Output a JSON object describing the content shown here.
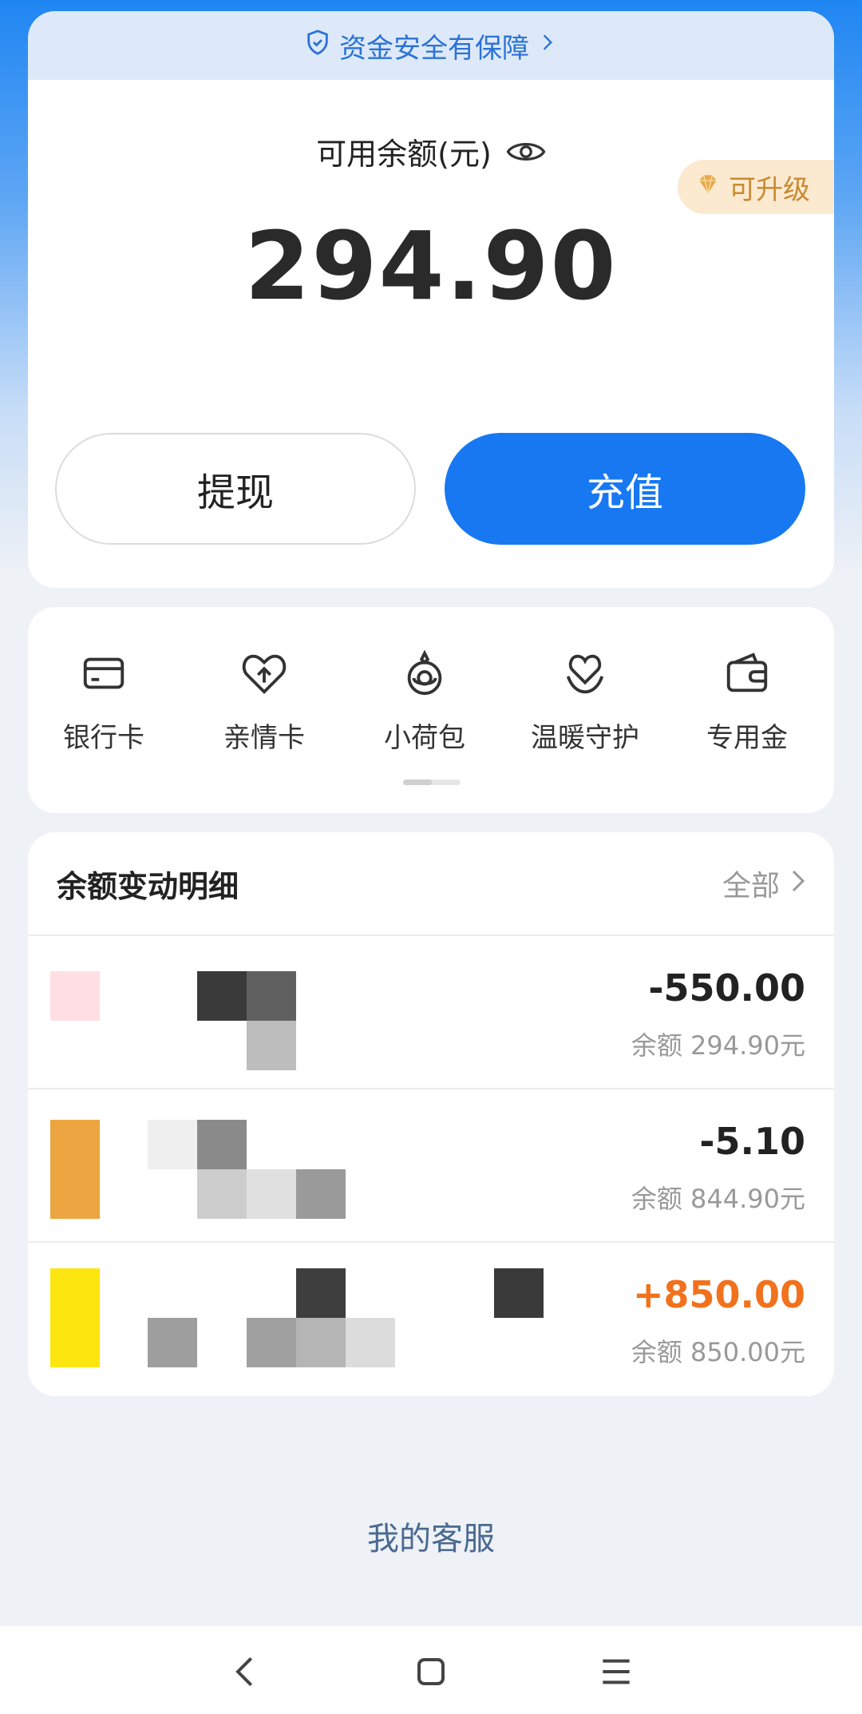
{
  "safety_banner": {
    "text": "资金安全有保障"
  },
  "balance": {
    "label": "可用余额(元)",
    "amount": "294.90",
    "upgrade_badge": "可升级"
  },
  "actions": {
    "withdraw_label": "提现",
    "recharge_label": "充值"
  },
  "shortcuts": [
    {
      "label": "银行卡",
      "icon": "bank-card-icon"
    },
    {
      "label": "亲情卡",
      "icon": "family-card-icon"
    },
    {
      "label": "小荷包",
      "icon": "small-purse-icon"
    },
    {
      "label": "温暖守护",
      "icon": "warm-guard-icon"
    },
    {
      "label": "专用金",
      "icon": "wallet-icon"
    }
  ],
  "transactions": {
    "title": "余额变动明细",
    "all_label": "全部",
    "rows": [
      {
        "amount": "-550.00",
        "balance": "余额 294.90元",
        "sign": "negative"
      },
      {
        "amount": "-5.10",
        "balance": "余额 844.90元",
        "sign": "negative"
      },
      {
        "amount": "+850.00",
        "balance": "余额 850.00元",
        "sign": "positive"
      }
    ]
  },
  "customer_service": {
    "label": "我的客服"
  },
  "colors": {
    "primary": "#1778f2",
    "positive_amount": "#f2711c",
    "upgrade": "#c98a32"
  }
}
